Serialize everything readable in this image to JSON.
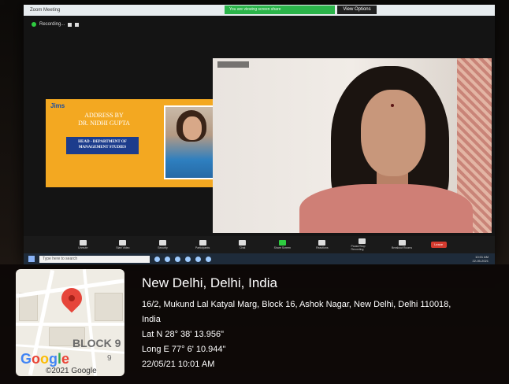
{
  "window": {
    "app_title": "Zoom Meeting",
    "share_banner": "You are viewing screen share",
    "view_options": "View Options"
  },
  "recording": {
    "label": "Recording..."
  },
  "slide": {
    "logo": "Jims",
    "address_line1": "ADDRESS BY",
    "address_line2": "DR. NIDHI GUPTA",
    "dept_line1": "HEAD - DEPARTMENT OF",
    "dept_line2": "MANAGEMENT STUDIES"
  },
  "toolbar": {
    "items": [
      {
        "label": "Unmute",
        "icon": "microphone-icon"
      },
      {
        "label": "Start Video",
        "icon": "video-icon"
      },
      {
        "label": "Security",
        "icon": "shield-icon"
      },
      {
        "label": "Participants",
        "icon": "participants-icon"
      },
      {
        "label": "Chat",
        "icon": "chat-icon"
      },
      {
        "label": "Share Screen",
        "icon": "share-screen-icon"
      },
      {
        "label": "Reactions",
        "icon": "reactions-icon"
      },
      {
        "label": "Pause/Stop Recording",
        "icon": "record-icon"
      },
      {
        "label": "Breakout Rooms",
        "icon": "breakout-icon"
      }
    ],
    "end_label": "Leave"
  },
  "taskbar": {
    "search_placeholder": "Type here to search",
    "time": "10:01 AM",
    "date": "22-05-2021"
  },
  "geotag": {
    "city": "New Delhi, Delhi, India",
    "address_line1": "16/2, Mukund Lal Katyal Marg, Block 16, Ashok Nagar, New Delhi, Delhi 110018,",
    "address_line2": "India",
    "lat": "Lat N 28° 38' 13.956\"",
    "long": "Long E 77° 6' 10.944\"",
    "datetime": "22/05/21 10:01 AM",
    "map": {
      "block_label": "BLOCK 9",
      "block_number": "9",
      "google_letters": [
        "G",
        "o",
        "o",
        "g",
        "l",
        "e"
      ],
      "copyright": "©2021 Google"
    }
  },
  "colors": {
    "accent_green": "#2ecc40",
    "slide_bg": "#f3a821",
    "leave_red": "#d53b2f",
    "pin_red": "#e6453a"
  }
}
